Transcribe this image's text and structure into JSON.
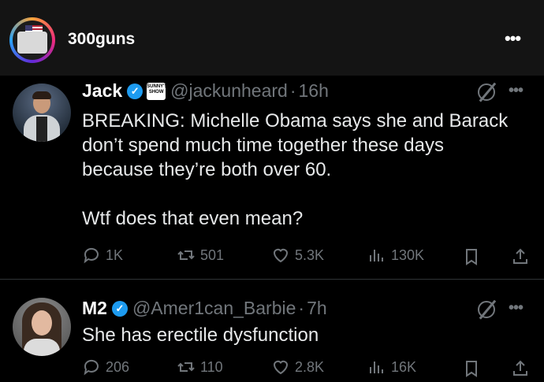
{
  "account": {
    "name": "300guns"
  },
  "tweets": [
    {
      "name": "Jack",
      "affiliate_badge": "SUNNY'S SHOW",
      "handle": "@jackunheard",
      "time": "16h",
      "text_lines": [
        "BREAKING: Michelle Obama says she and Barack",
        "don’t spend much time together these days",
        "because they’re both over 60.",
        "",
        "Wtf does that even mean?"
      ],
      "replies": "1K",
      "reposts": "501",
      "likes": "5.3K",
      "views": "130K"
    },
    {
      "name": "M2",
      "handle": "@Amer1can_Barbie",
      "time": "7h",
      "text_lines": [
        "She has erectile dysfunction"
      ],
      "replies": "206",
      "reposts": "110",
      "likes": "2.8K",
      "views": "16K"
    }
  ],
  "icons": {
    "verified": "verified-check-icon",
    "grok": "grok-icon",
    "more": "more-dots-icon",
    "reply": "reply-icon",
    "repost": "repost-icon",
    "like": "heart-icon",
    "views": "views-icon",
    "bookmark": "bookmark-icon",
    "share": "share-icon"
  },
  "colors": {
    "background": "#000000",
    "verified": "#1d9bf0",
    "muted": "#71767b"
  }
}
